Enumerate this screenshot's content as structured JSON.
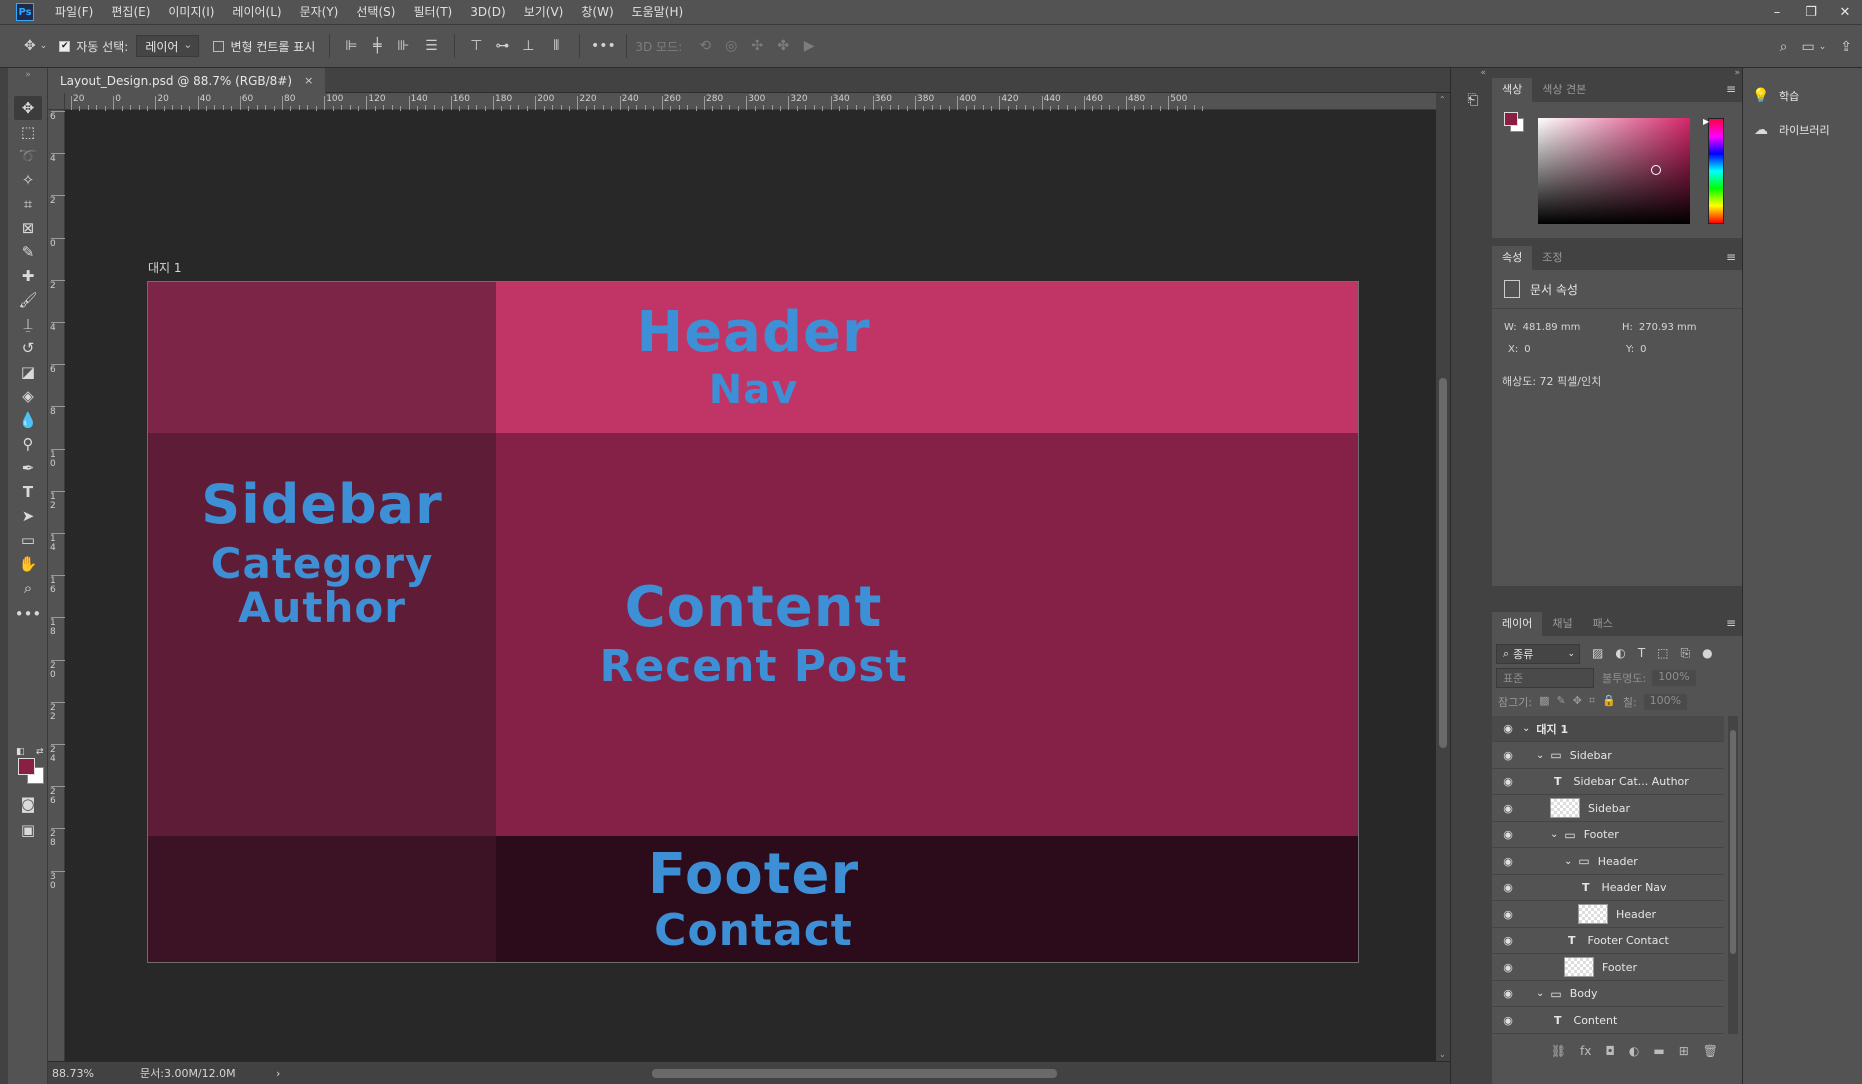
{
  "app": {
    "logo": "Ps"
  },
  "menu": [
    {
      "id": "file",
      "label": "파일(F)"
    },
    {
      "id": "edit",
      "label": "편집(E)"
    },
    {
      "id": "image",
      "label": "이미지(I)"
    },
    {
      "id": "layer",
      "label": "레이어(L)"
    },
    {
      "id": "type",
      "label": "문자(Y)"
    },
    {
      "id": "select",
      "label": "선택(S)"
    },
    {
      "id": "filter",
      "label": "필터(T)"
    },
    {
      "id": "3d",
      "label": "3D(D)"
    },
    {
      "id": "view",
      "label": "보기(V)"
    },
    {
      "id": "window",
      "label": "창(W)"
    },
    {
      "id": "help",
      "label": "도움말(H)"
    }
  ],
  "window_controls": {
    "minimize": "–",
    "restore": "❐",
    "close": "✕"
  },
  "options_bar": {
    "auto_select_label": "자동 선택:",
    "auto_select_value": "레이어",
    "transform_controls_label": "변형 컨트롤 표시",
    "more": "•••",
    "mode_3d_label": "3D 모드:"
  },
  "document": {
    "tab_title": "Layout_Design.psd @ 88.7% (RGB/8#)",
    "close": "×",
    "artboard_label": "대지 1"
  },
  "ruler": {
    "top_ticks": [
      "20",
      "0",
      "20",
      "40",
      "60",
      "80",
      "100",
      "120",
      "140",
      "160",
      "180",
      "200",
      "220",
      "240",
      "260",
      "280",
      "300",
      "320",
      "340",
      "360",
      "380",
      "400",
      "420",
      "440",
      "460",
      "480",
      "500"
    ],
    "left_ticks": [
      "6",
      "4",
      "2",
      "0",
      "2",
      "4",
      "6",
      "8",
      "10",
      "12",
      "14",
      "16",
      "18",
      "20",
      "22",
      "24",
      "26",
      "28",
      "30"
    ]
  },
  "design": {
    "header_title": "Header",
    "header_sub": "Nav",
    "sidebar_title": "Sidebar",
    "sidebar_sub1": "Category",
    "sidebar_sub2": "Author",
    "content_title": "Content",
    "content_sub": "Recent Post",
    "footer_title": "Footer",
    "footer_sub": "Contact",
    "colors": {
      "header_left": "#7d2546",
      "header_right": "#c03565",
      "sidebar": "#5e1c36",
      "content": "#852146",
      "footer_left": "#3c1325",
      "footer_right": "#2c0c1a",
      "text": "#3d8fd6"
    }
  },
  "status": {
    "zoom": "88.73%",
    "doc_size": "문서:3.00M/12.0M",
    "arrow": "›"
  },
  "color_panel": {
    "tab_color": "색상",
    "tab_swatches": "색상 견본",
    "foreground": "#8a1f43"
  },
  "properties_panel": {
    "tab_properties": "속성",
    "tab_adjust": "조정",
    "section_title": "문서 속성",
    "w_label": "W:",
    "w_value": "481.89 mm",
    "h_label": "H:",
    "h_value": "270.93 mm",
    "x_label": "X:",
    "x_value": "0",
    "y_label": "Y:",
    "y_value": "0",
    "resolution": "해상도: 72 픽셀/인치"
  },
  "layers_panel": {
    "tab_layers": "레이어",
    "tab_channels": "채널",
    "tab_paths": "패스",
    "filter_kind": "종류",
    "blend_mode": "표준",
    "opacity_label": "불투명도:",
    "opacity_value": "100%",
    "lock_label": "잠그기:",
    "fill_label": "칠:",
    "fill_value": "100%",
    "layers": [
      {
        "name": "대지 1",
        "kind": "artboard",
        "indent": 0
      },
      {
        "name": "Sidebar",
        "kind": "group",
        "indent": 1
      },
      {
        "name": "Sidebar Cat... Author",
        "kind": "text",
        "indent": 2
      },
      {
        "name": "Sidebar",
        "kind": "shape",
        "indent": 2
      },
      {
        "name": "Footer",
        "kind": "group",
        "indent": 2
      },
      {
        "name": "Header",
        "kind": "group",
        "indent": 3
      },
      {
        "name": "Header Nav",
        "kind": "text",
        "indent": 4
      },
      {
        "name": "Header",
        "kind": "shape",
        "indent": 4
      },
      {
        "name": "Footer Contact",
        "kind": "text",
        "indent": 3
      },
      {
        "name": "Footer",
        "kind": "shape",
        "indent": 3
      },
      {
        "name": "Body",
        "kind": "group",
        "indent": 1
      },
      {
        "name": "Content",
        "kind": "text",
        "indent": 2
      }
    ]
  },
  "right_dock": {
    "learn": "학습",
    "libraries": "라이브러리"
  }
}
